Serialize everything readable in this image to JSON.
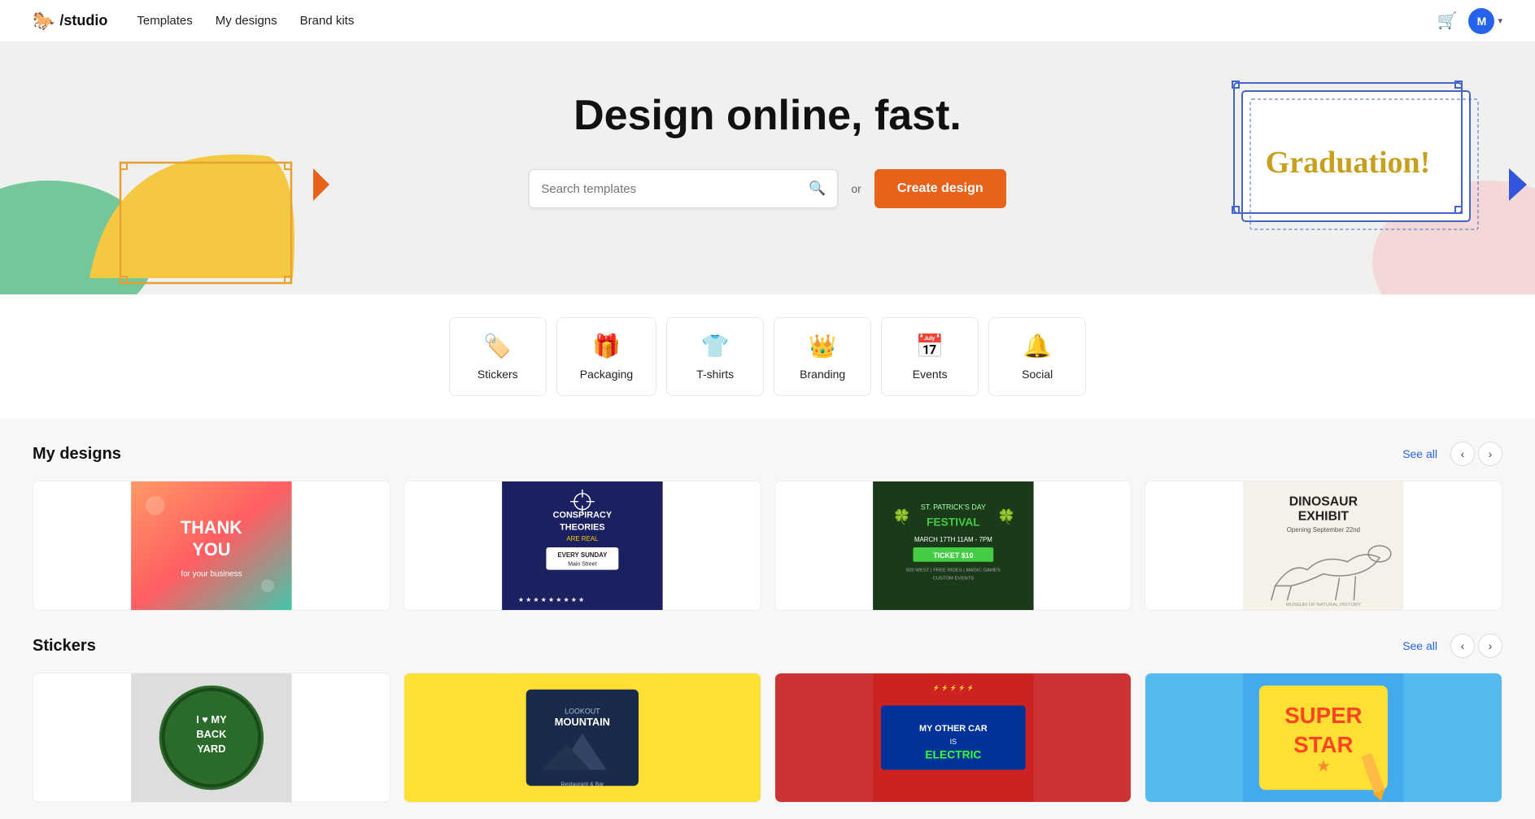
{
  "nav": {
    "logo_icon": "🐎",
    "logo_text": "/studio",
    "links": [
      "Templates",
      "My designs",
      "Brand kits"
    ],
    "cart_label": "cart",
    "avatar_letter": "M"
  },
  "hero": {
    "headline": "Design online, fast.",
    "search_placeholder": "Search templates",
    "or_text": "or",
    "create_btn_label": "Create design"
  },
  "categories": [
    {
      "icon": "🏷️",
      "label": "Stickers"
    },
    {
      "icon": "🎁",
      "label": "Packaging"
    },
    {
      "icon": "👕",
      "label": "T-shirts"
    },
    {
      "icon": "👑",
      "label": "Branding"
    },
    {
      "icon": "📅",
      "label": "Events"
    },
    {
      "icon": "🔔",
      "label": "Social"
    }
  ],
  "my_designs": {
    "section_title": "My designs",
    "see_all_label": "See all",
    "cards": [
      {
        "id": 1,
        "alt": "Thank you card - colorful gradient"
      },
      {
        "id": 2,
        "alt": "Conspiracy Theories poster - dark blue"
      },
      {
        "id": 3,
        "alt": "St. Patrick's Day Festival - dark green"
      },
      {
        "id": 4,
        "alt": "Dinosaur Exhibit - beige"
      }
    ]
  },
  "stickers": {
    "section_title": "Stickers",
    "see_all_label": "See all",
    "cards": [
      {
        "id": 1,
        "alt": "I love my backyard - circular green sticker"
      },
      {
        "id": 2,
        "alt": "Lookout Mountain Restaurant & Bar - dark blue"
      },
      {
        "id": 3,
        "alt": "My other car is electric - red sticker"
      },
      {
        "id": 4,
        "alt": "Super Star - yellow sticker"
      }
    ]
  },
  "colors": {
    "create_btn": "#e8621a",
    "see_all": "#2563eb",
    "avatar_bg": "#2563eb"
  }
}
